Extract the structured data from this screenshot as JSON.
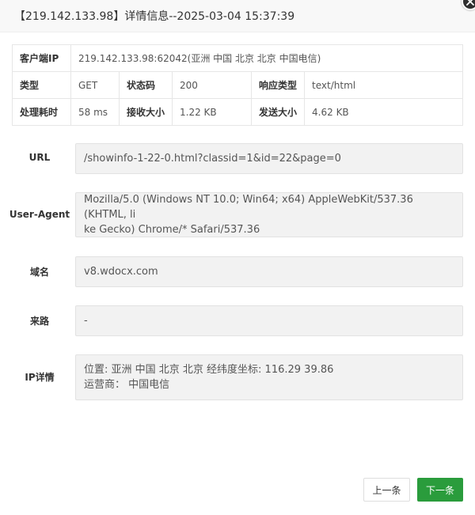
{
  "dialog": {
    "title": "【219.142.133.98】详情信息--2025-03-04 15:37:39"
  },
  "summary": {
    "client_ip_label": "客户端IP",
    "client_ip_value": "219.142.133.98:62042(亚洲 中国 北京 北京 中国电信)",
    "type_label": "类型",
    "type_value": "GET",
    "status_label": "状态码",
    "status_value": "200",
    "resp_type_label": "响应类型",
    "resp_type_value": "text/html",
    "duration_label": "处理耗时",
    "duration_value": "58 ms",
    "recv_label": "接收大小",
    "recv_value": "1.22 KB",
    "sent_label": "发送大小",
    "sent_value": "4.62 KB"
  },
  "fields": {
    "url_label": "URL",
    "url_value": "/showinfo-1-22-0.html?classid=1&id=22&page=0",
    "ua_label": "User-Agent",
    "ua_line1": "Mozilla/5.0 (Windows NT 10.0; Win64; x64) AppleWebKit/537.36 (KHTML, li",
    "ua_line2": "ke Gecko) Chrome/* Safari/537.36",
    "domain_label": "域名",
    "domain_value": "v8.wdocx.com",
    "referer_label": "来路",
    "referer_value": "-",
    "ipinfo_label": "IP详情",
    "ipinfo_line1": "位置: 亚洲 中国 北京 北京 经纬度坐标: 116.29 39.86",
    "ipinfo_line2": "运营商： 中国电信"
  },
  "buttons": {
    "prev_label": "上一条",
    "next_label": "下一条"
  },
  "colors": {
    "next_button": "#2a9c3c",
    "field_background": "#f2f2f2"
  },
  "icons": {
    "close": "close-icon"
  }
}
